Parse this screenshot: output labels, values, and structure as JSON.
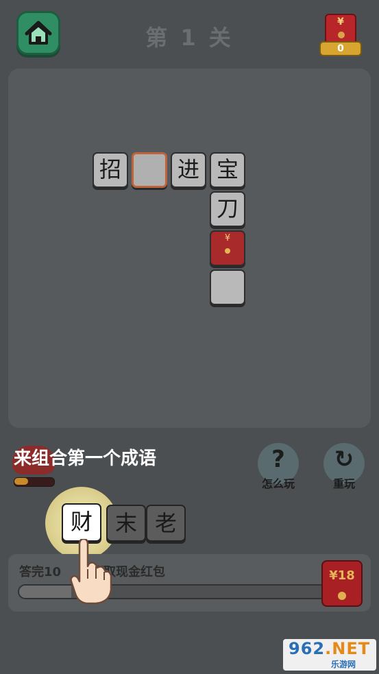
{
  "header": {
    "home_icon": "home-icon",
    "level_title": "第 1 关",
    "reward_count": "0",
    "reward_yen": "¥"
  },
  "board": {
    "tiles": [
      "招",
      "",
      "进",
      "宝",
      "刀",
      "¥",
      ""
    ],
    "selected_index": 1
  },
  "hint": {
    "text": "来组合第一个成语",
    "help_label": "怎么玩",
    "help_icon": "?",
    "replay_label": "重玩",
    "replay_icon": "↻",
    "bag_progress": 0.35
  },
  "choices": [
    "财",
    "末",
    "老"
  ],
  "progress_panel": {
    "goal_text": "答完10",
    "goal_text_tail": "领取现金红包",
    "progress": 0.17,
    "cash_amount": "¥18"
  },
  "watermark": {
    "number": "962",
    "suffix": ".NET",
    "caption": "乐游网"
  },
  "colors": {
    "background": "#4c4f51",
    "home_green": "#2f8e63",
    "envelope_red": "#b8262a",
    "gold": "#d8a630"
  }
}
